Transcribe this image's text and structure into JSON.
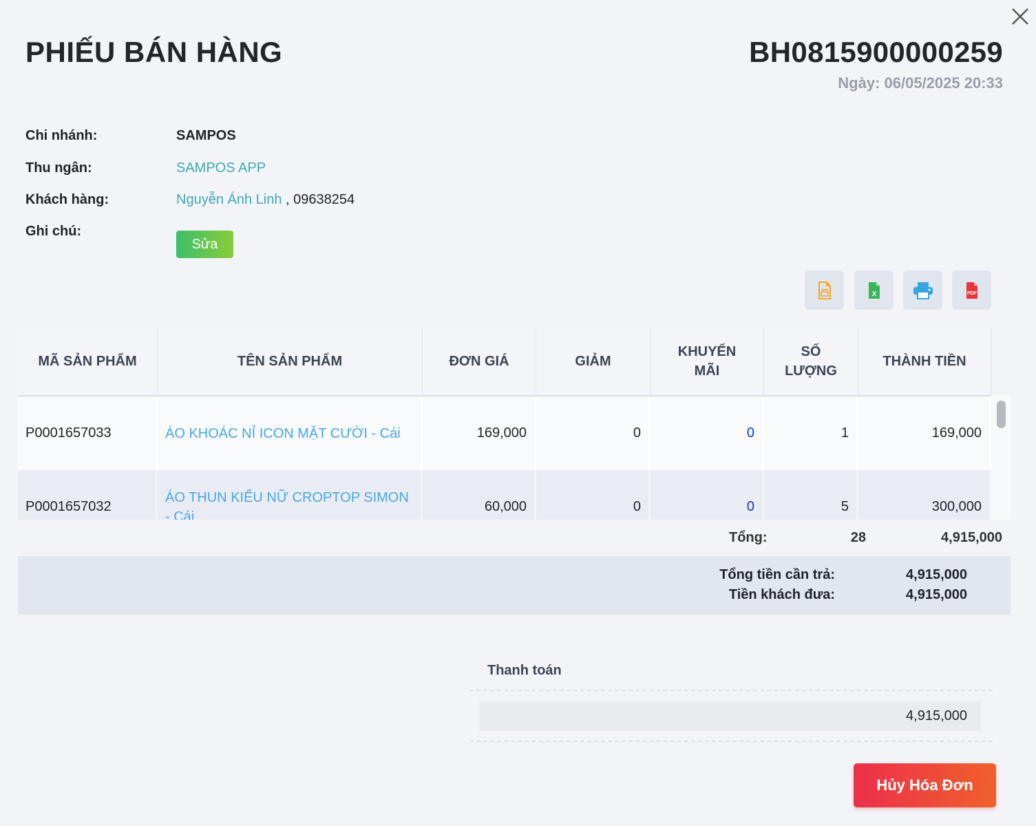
{
  "header": {
    "title": "PHIẾU BÁN HÀNG",
    "invoice_code": "BH0815900000259",
    "date": "Ngày: 06/05/2025 20:33"
  },
  "info": {
    "branch_label": "Chi nhánh:",
    "branch_value": "SAMPOS",
    "cashier_label": "Thu ngân:",
    "cashier_value": "SAMPOS APP",
    "customer_label": "Khách hàng:",
    "customer_name": "Nguyễn Ánh Linh",
    "customer_phone": " , 09638254",
    "note_label": "Ghi chú:",
    "edit_label": "Sửa"
  },
  "toolbar": {
    "icons": [
      "document-icon",
      "excel-icon",
      "printer-icon",
      "pdf-icon"
    ],
    "colors": {
      "document": "#f5a623",
      "excel": "#3cb55a",
      "printer": "#35a5e0",
      "pdf": "#e8343c"
    }
  },
  "table": {
    "headers": {
      "code": "MÃ SẢN PHẨM",
      "name": "TÊN SẢN PHẨM",
      "price": "ĐƠN GIÁ",
      "discount": "GIẢM",
      "promo_line1": "KHUYẾN",
      "promo_line2": "MÃI",
      "qty_line1": "SỐ",
      "qty_line2": "LƯỢNG",
      "total": "THÀNH TIỀN"
    },
    "rows": [
      {
        "code": "P0001657033",
        "name": "ÁO KHOÁC NỈ ICON MẶT CƯỜI - Cái",
        "price": "169,000",
        "discount": "0",
        "promo": "0",
        "qty": "1",
        "total": "169,000"
      },
      {
        "code": "P0001657032",
        "name": "ÁO THUN KIỂU NỮ CROPTOP SIMON - Cái",
        "price": "60,000",
        "discount": "0",
        "promo": "0",
        "qty": "5",
        "total": "300,000"
      }
    ]
  },
  "totals": {
    "label": "Tổng:",
    "qty": "28",
    "amount": "4,915,000"
  },
  "summary": {
    "due_label": "Tổng tiền cần trả:",
    "due_value": "4,915,000",
    "paid_label": "Tiền khách đưa:",
    "paid_value": "4,915,000"
  },
  "payment": {
    "title": "Thanh toán",
    "amount": "4,915,000"
  },
  "actions": {
    "cancel_label": "Hủy Hóa Đơn"
  }
}
